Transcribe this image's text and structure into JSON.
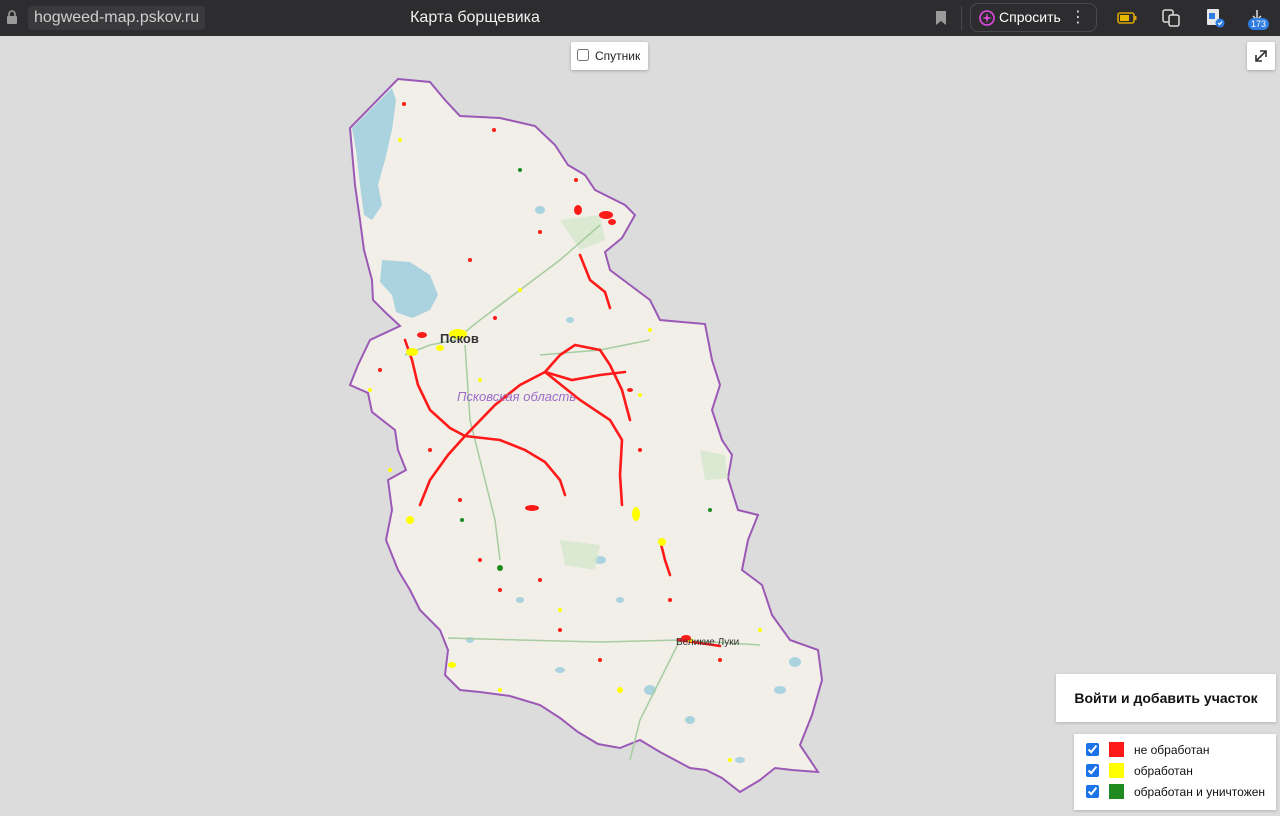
{
  "browser": {
    "url": "hogweed-map.pskov.ru",
    "page_title": "Карта борщевика",
    "ask_label": "Спросить",
    "downloads_count": "173"
  },
  "map": {
    "satellite_label": "Спутник",
    "region_label": "Псковская область",
    "city_pskov": "Псков",
    "city_vluki": "Великие Луки"
  },
  "login_button": "Войти и добавить участок",
  "legend": {
    "items": [
      {
        "label": "не обработан",
        "color": "#ff1a1a"
      },
      {
        "label": "обработан",
        "color": "#ffff00"
      },
      {
        "label": "обработан и уничтожен",
        "color": "#1f8a1f"
      }
    ]
  },
  "colors": {
    "region_border": "#9b59b6",
    "land": "#f2efe9",
    "water": "#aad3df",
    "forest": "#c8dfc0",
    "chrome_bg": "#2d2d2f"
  }
}
